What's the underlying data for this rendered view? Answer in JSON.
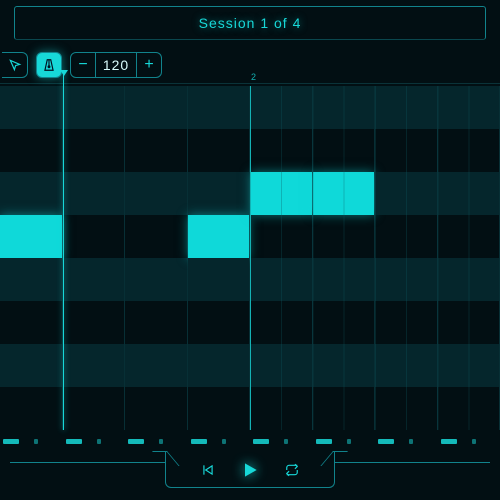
{
  "header": {
    "title": "Session 1 of 4"
  },
  "toolbar": {
    "tool1_icon": "cursor-icon",
    "tool2_icon": "metronome-icon",
    "tool2_active": true,
    "tempo": "120",
    "dec_label": "−",
    "inc_label": "+"
  },
  "grid": {
    "rows": 8,
    "cols": 8,
    "bar2_at_col": 4,
    "bar2_label": "2",
    "playhead_col": 1,
    "notes": [
      {
        "row": 3,
        "col": 0
      },
      {
        "row": 3,
        "col": 3
      },
      {
        "row": 2,
        "col": 4
      },
      {
        "row": 2,
        "col": 5
      }
    ],
    "alt_rows": [
      0,
      2,
      4,
      6
    ]
  },
  "kicktrack": {
    "cells": 16,
    "hits": [
      0,
      1,
      2,
      3,
      4,
      5,
      6,
      7,
      8,
      9,
      10,
      11,
      12,
      13,
      14,
      15
    ],
    "accents": [
      0,
      2,
      4,
      6,
      8,
      10,
      12,
      14
    ]
  },
  "transport": {
    "prev_icon": "skip-back-icon",
    "play_icon": "play-icon",
    "loop_icon": "loop-icon"
  }
}
